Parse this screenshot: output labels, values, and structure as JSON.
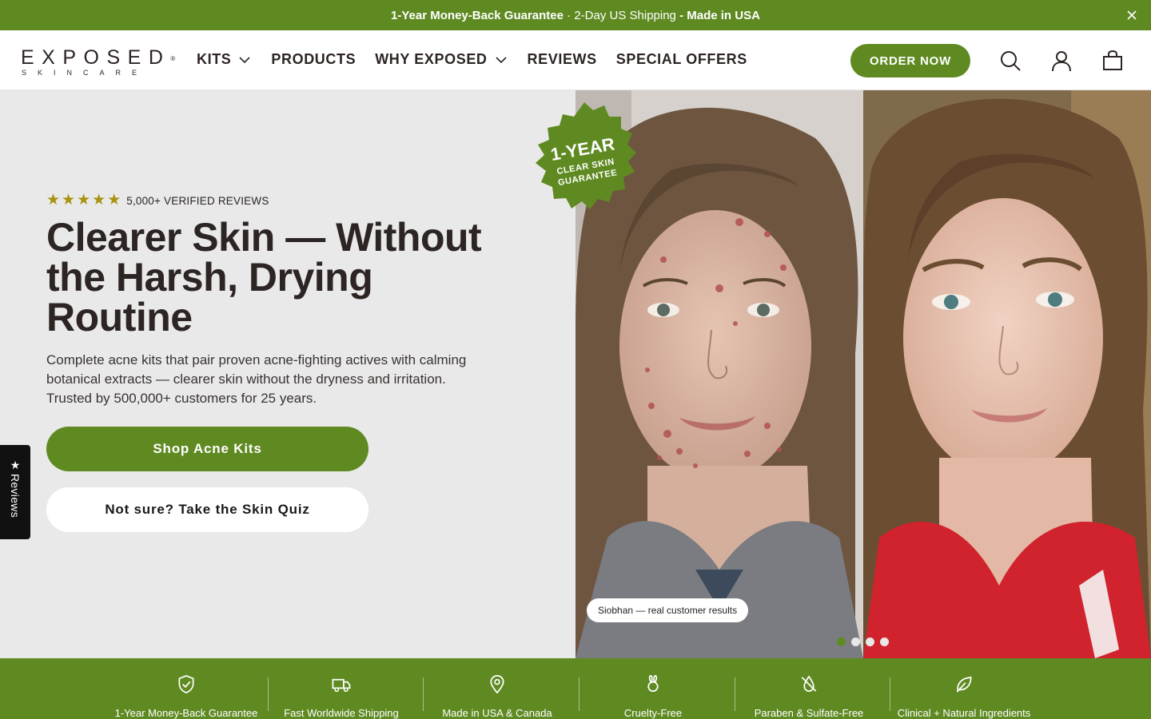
{
  "announcement": {
    "part1": "1-Year Money-Back Guarantee",
    "sep": " · ",
    "part2": "2-Day US Shipping",
    "part3": " - ",
    "part4": "Made in USA"
  },
  "brand": {
    "word": "EXPOSED",
    "mark": "®",
    "sub": "SKINCARE"
  },
  "nav": {
    "items": [
      {
        "label": "KITS",
        "has_dropdown": true
      },
      {
        "label": "PRODUCTS",
        "has_dropdown": false
      },
      {
        "label": "WHY EXPOSED",
        "has_dropdown": true
      },
      {
        "label": "REVIEWS",
        "has_dropdown": false
      },
      {
        "label": "SPECIAL OFFERS",
        "has_dropdown": false
      }
    ],
    "order_label": "ORDER NOW",
    "icons": [
      "search-icon",
      "account-icon",
      "cart-icon"
    ]
  },
  "hero": {
    "rating_stars": 5,
    "reviews_text": "5,000+ VERIFIED REVIEWS",
    "headline": "Clearer Skin — Without the Harsh, Drying Routine",
    "subtext": "Complete acne kits that pair proven acne-fighting actives with calming botanical extracts — clearer skin without the dryness and irritation. Trusted by 500,000+ customers for 25 years.",
    "primary_cta": "Shop Acne Kits",
    "secondary_cta": "Not sure? Take the Skin Quiz"
  },
  "reviews_tab": {
    "label": "Reviews"
  },
  "badge": {
    "line1": "1-YEAR",
    "line2": "CLEAR SKIN",
    "line3": "GUARANTEE"
  },
  "carousel": {
    "caption": "Siobhan — real customer results",
    "slide_count": 4,
    "active_index": 0
  },
  "features": [
    {
      "label": "1-Year Money-Back Guarantee",
      "icon": "shield-check-icon"
    },
    {
      "label": "Fast Worldwide Shipping",
      "icon": "truck-icon"
    },
    {
      "label": "Made in USA & Canada",
      "icon": "location-pin-icon"
    },
    {
      "label": "Cruelty-Free",
      "icon": "bunny-icon"
    },
    {
      "label": "Paraben & Sulfate-Free",
      "icon": "no-drop-icon"
    },
    {
      "label": "Clinical + Natural Ingredients",
      "icon": "leaf-icon"
    }
  ],
  "colors": {
    "brand_green": "#5f8a22",
    "star_gold": "#a8920f",
    "text_dark": "#2d2524",
    "hero_bg": "#e9e9e9"
  }
}
